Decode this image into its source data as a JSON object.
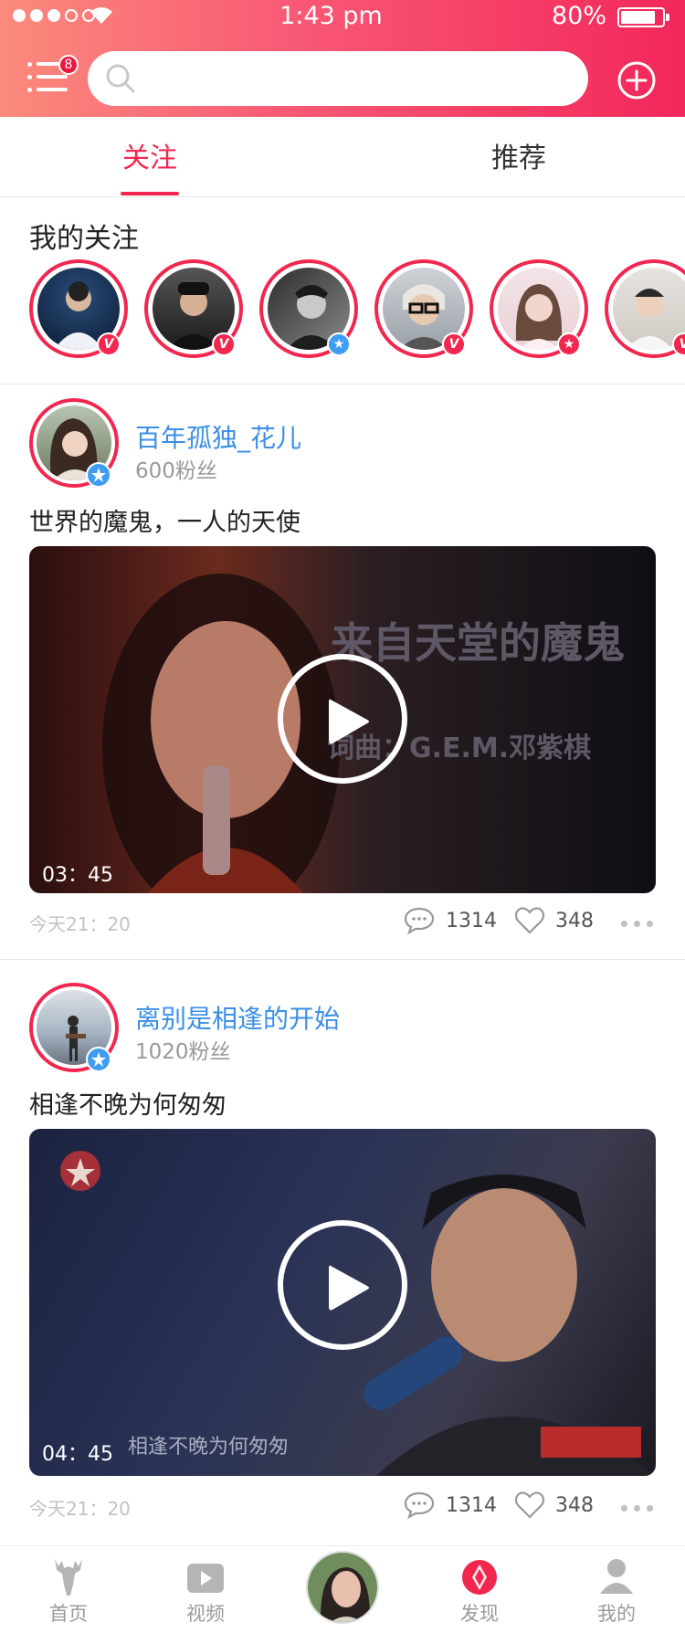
{
  "status_bar": {
    "time": "1:43 pm",
    "battery": "80%"
  },
  "header": {
    "menu_badge": "8",
    "search_placeholder": ""
  },
  "tabs": [
    {
      "label": "关注",
      "active": true
    },
    {
      "label": "推荐",
      "active": false
    }
  ],
  "following": {
    "title": "我的关注",
    "avatars": [
      {
        "badge": "V"
      },
      {
        "badge": "V"
      },
      {
        "badge": "star-blue"
      },
      {
        "badge": "V"
      },
      {
        "badge": "star-red"
      },
      {
        "badge": "V"
      }
    ]
  },
  "posts": [
    {
      "author": "百年孤独_花儿",
      "fans": "600粉丝",
      "text": "世界的魔鬼，一人的天使",
      "duration": "03：45",
      "video_caption_1": "来自天堂的魔鬼",
      "video_caption_2": "词曲：G.E.M.邓紫棋",
      "time": "今天21：20",
      "comments": "1314",
      "likes": "348"
    },
    {
      "author": "离别是相逢的开始",
      "fans": "1020粉丝",
      "text": "相逢不晚为何匆匆",
      "duration": "04：45",
      "video_caption_1": "相逢不晚为何匆匆",
      "time": "今天21：20",
      "comments": "1314",
      "likes": "348"
    }
  ],
  "bottom_nav": [
    {
      "label": "首页",
      "icon": "deer-icon",
      "active": false
    },
    {
      "label": "视频",
      "icon": "video-play-icon",
      "active": false
    },
    {
      "label": "",
      "icon": "center-avatar",
      "active": false
    },
    {
      "label": "发现",
      "icon": "discover-icon",
      "active": true
    },
    {
      "label": "我的",
      "icon": "person-icon",
      "active": false
    }
  ],
  "colors": {
    "accent": "#f2274f",
    "link": "#3b8fe6",
    "header_start": "#fb8a7c",
    "header_end": "#f2275a"
  }
}
